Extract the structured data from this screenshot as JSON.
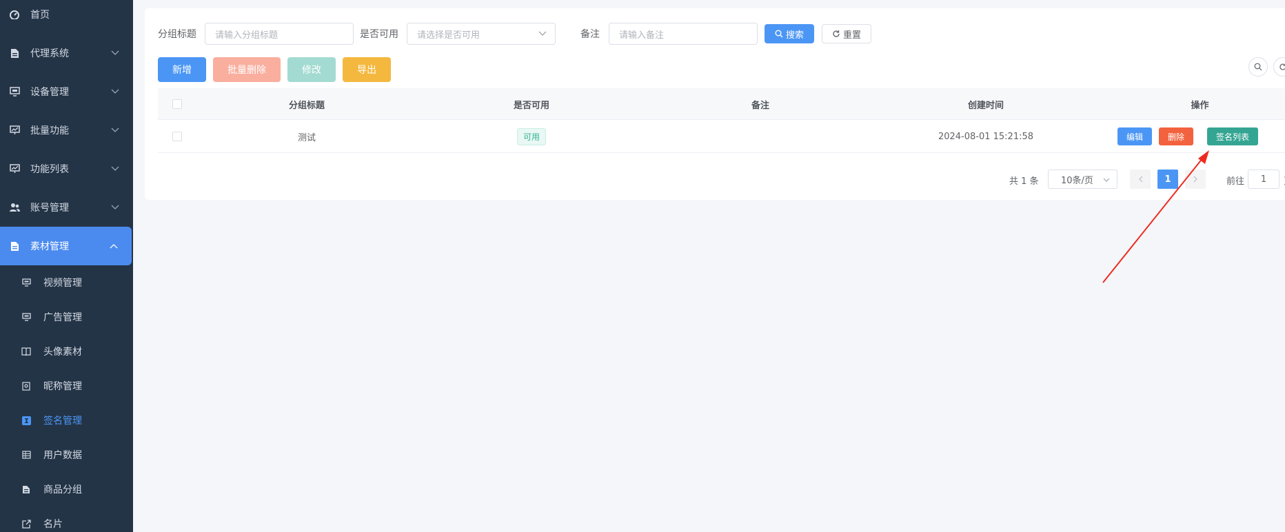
{
  "sidebar": {
    "items": [
      {
        "label": "首页"
      },
      {
        "label": "代理系统"
      },
      {
        "label": "设备管理"
      },
      {
        "label": "批量功能"
      },
      {
        "label": "功能列表"
      },
      {
        "label": "账号管理"
      },
      {
        "label": "素材管理"
      }
    ],
    "sub_items": [
      {
        "label": "视频管理"
      },
      {
        "label": "广告管理"
      },
      {
        "label": "头像素材"
      },
      {
        "label": "昵称管理"
      },
      {
        "label": "签名管理"
      },
      {
        "label": "用户数据"
      },
      {
        "label": "商品分组"
      },
      {
        "label": "名片"
      }
    ],
    "active_sub_item": "签名管理"
  },
  "filters": {
    "title_label": "分组标题",
    "title_placeholder": "请输入分组标题",
    "available_label": "是否可用",
    "available_placeholder": "请选择是否可用",
    "remark_label": "备注",
    "remark_placeholder": "请输入备注",
    "search_label": "搜索",
    "reset_label": "重置"
  },
  "toolbar": {
    "add_label": "新增",
    "batch_delete_label": "批量删除",
    "edit_label": "修改",
    "export_label": "导出"
  },
  "table": {
    "columns": [
      "分组标题",
      "是否可用",
      "备注",
      "创建时间",
      "操作"
    ],
    "rows": [
      {
        "title": "测试",
        "available": "可用",
        "remark": "",
        "created_at": "2024-08-01 15:21:58",
        "actions": {
          "edit": "编辑",
          "delete": "删除",
          "signature_list": "签名列表"
        }
      }
    ]
  },
  "pagination": {
    "total_text": "共 1 条",
    "page_size": "10条/页",
    "current_page": "1",
    "goto_label": "前往",
    "goto_value": "1",
    "page_suffix": "页"
  },
  "colors": {
    "sidebar_bg": "#243447",
    "accent": "#4b96f5",
    "danger": "#f3623e",
    "success": "#35a593",
    "warning": "#f4b83f",
    "annotation_arrow": "#ee2a20"
  }
}
